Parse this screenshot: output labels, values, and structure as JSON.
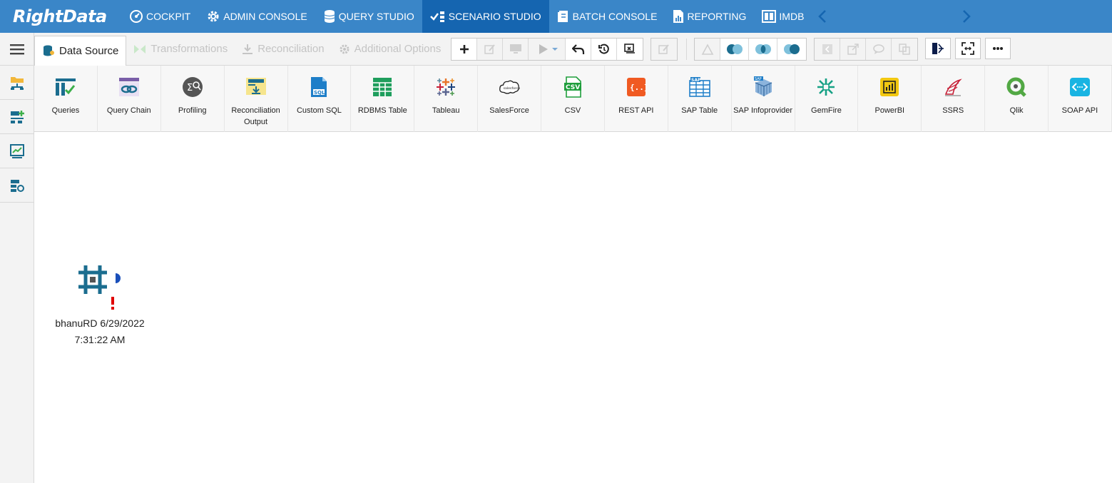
{
  "app": {
    "logo": "RightData"
  },
  "nav": {
    "items": [
      {
        "label": "COCKPIT",
        "icon": "cockpit-icon"
      },
      {
        "label": "ADMIN CONSOLE",
        "icon": "gear-icon"
      },
      {
        "label": "QUERY STUDIO",
        "icon": "database-icon"
      },
      {
        "label": "SCENARIO STUDIO",
        "icon": "scenario-icon",
        "active": true
      },
      {
        "label": "BATCH CONSOLE",
        "icon": "batch-icon"
      },
      {
        "label": "REPORTING",
        "icon": "report-icon"
      },
      {
        "label": "IMDB",
        "icon": "imdb-icon"
      }
    ]
  },
  "tabs": [
    {
      "label": "Data Source",
      "active": true
    },
    {
      "label": "Transformations"
    },
    {
      "label": "Reconciliation"
    },
    {
      "label": "Additional Options"
    }
  ],
  "datasources": [
    {
      "label": "Queries",
      "icon": "queries-icon"
    },
    {
      "label": "Query Chain",
      "icon": "query-chain-icon"
    },
    {
      "label": "Profiling",
      "icon": "profiling-icon"
    },
    {
      "label": "Reconciliation Output",
      "icon": "reconciliation-output-icon"
    },
    {
      "label": "Custom SQL",
      "icon": "custom-sql-icon"
    },
    {
      "label": "RDBMS Table",
      "icon": "rdbms-table-icon"
    },
    {
      "label": "Tableau",
      "icon": "tableau-icon"
    },
    {
      "label": "SalesForce",
      "icon": "salesforce-icon"
    },
    {
      "label": "CSV",
      "icon": "csv-icon"
    },
    {
      "label": "REST API",
      "icon": "rest-api-icon"
    },
    {
      "label": "SAP Table",
      "icon": "sap-table-icon"
    },
    {
      "label": "SAP Infoprovider",
      "icon": "sap-infoprovider-icon"
    },
    {
      "label": "GemFire",
      "icon": "gemfire-icon"
    },
    {
      "label": "PowerBI",
      "icon": "powerbi-icon"
    },
    {
      "label": "SSRS",
      "icon": "ssrs-icon"
    },
    {
      "label": "Qlik",
      "icon": "qlik-icon"
    },
    {
      "label": "SOAP API",
      "icon": "soap-api-icon"
    }
  ],
  "canvas": {
    "node": {
      "label_line1": "bhanuRD 6/29/2022",
      "label_line2": "7:31:22 AM",
      "warning": "!"
    }
  },
  "colors": {
    "nav_bg": "#3a86c8",
    "nav_active": "#1565b0",
    "accent": "#1b6d8f"
  }
}
